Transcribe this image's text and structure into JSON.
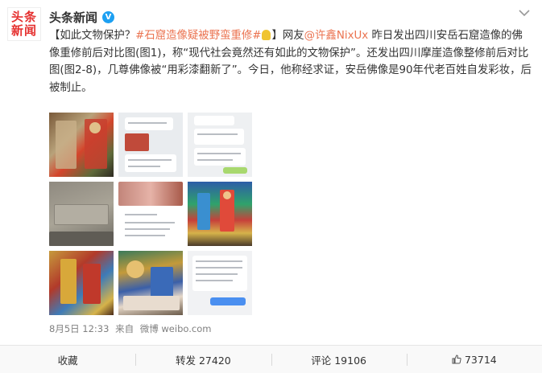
{
  "account": {
    "avatar_line1": "头条",
    "avatar_line2": "新闻",
    "name": "头条新闻",
    "verified_mark": "V"
  },
  "post": {
    "open_bracket": "【",
    "lead": "如此文物保护？",
    "hashtag": "#石窟造像疑被野蛮重修#",
    "mid1": "】网友",
    "mention": "@许鑫NixUx",
    "body": " 昨日发出四川安岳石窟造像的佛像重修前后对比图(图1)，称“现代社会竟然还有如此的文物保护”。还发出四川摩崖造像整修前后对比图(图2-8)，几尊佛像被“用彩漆翻新了”。今日，他称经求证，安岳佛像是90年代老百姓自发彩妆，后被制止。",
    "time": "8月5日 12:33",
    "source_prefix": "来自",
    "source": "微博 weibo.com"
  },
  "images": [
    {
      "name": "image-1-buddha-comparison"
    },
    {
      "name": "image-2-chat-screenshot"
    },
    {
      "name": "image-3-chat-screenshot"
    },
    {
      "name": "image-4-stone-carving"
    },
    {
      "name": "image-5-chat-screenshot"
    },
    {
      "name": "image-6-painted-statues"
    },
    {
      "name": "image-7-painted-statues"
    },
    {
      "name": "image-8-painted-cave"
    },
    {
      "name": "image-9-chat-screenshot"
    }
  ],
  "actions": {
    "collect": "收藏",
    "repost": "转发 27420",
    "comment": "评论 19106",
    "like": "73714"
  },
  "icons": {
    "more": "chevron-down-icon",
    "like": "thumbs-up-icon",
    "bulb": "lightbulb-icon"
  },
  "colors": {
    "brand_red": "#e5302f",
    "link": "#eb7350",
    "verified": "#1da0f2"
  }
}
